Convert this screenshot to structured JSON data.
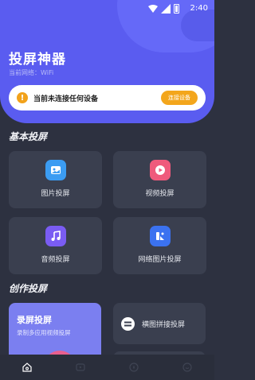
{
  "status_bar": {
    "time": "2:40"
  },
  "header": {
    "title": "投屏神器",
    "network_label": "当前网络：WiFi"
  },
  "connect": {
    "text": "当前未连接任何设备",
    "button": "连接设备"
  },
  "basic_section": {
    "title": "基本投屏",
    "cards": [
      {
        "label": "图片投屏",
        "icon": "image-icon",
        "color": "#3b9cf2"
      },
      {
        "label": "视频投屏",
        "icon": "video-play-icon",
        "color": "#ef5a7c"
      },
      {
        "label": "音频投屏",
        "icon": "music-note-icon",
        "color": "#7a5cf3"
      },
      {
        "label": "网络图片投屏",
        "icon": "web-image-icon",
        "color": "#3b72f0"
      }
    ]
  },
  "creative_section": {
    "title": "创作投屏",
    "record_card": {
      "title": "录屏投屏",
      "subtitle": "录制多应用视频投屏"
    },
    "splice_card": {
      "label": "横图拼接投屏"
    }
  },
  "bottom_nav": {
    "items": [
      {
        "icon": "home-icon",
        "active": true
      },
      {
        "icon": "cast-icon",
        "active": false
      },
      {
        "icon": "discover-icon",
        "active": false
      },
      {
        "icon": "profile-icon",
        "active": false
      }
    ]
  },
  "colors": {
    "accent": "#5a5cf0",
    "background": "#2d3140",
    "card": "#3a3f4f",
    "warning": "#f3a61c"
  }
}
